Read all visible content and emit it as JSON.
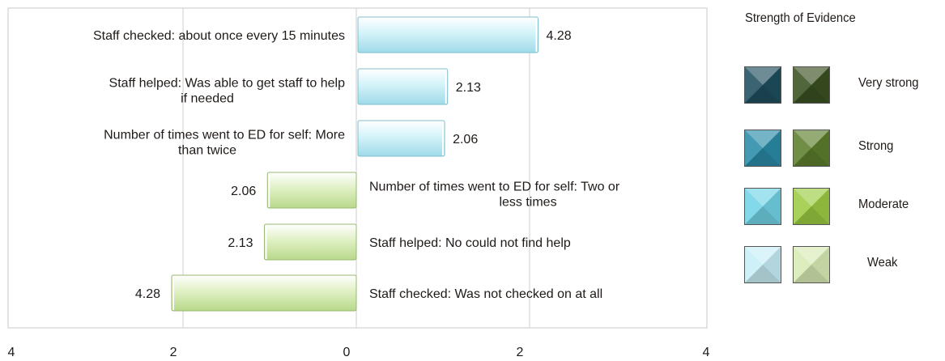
{
  "chart_data": {
    "type": "bar",
    "orientation": "horizontal",
    "xlim": [
      -4,
      4
    ],
    "x_tick_labels": [
      "4",
      "2",
      "0",
      "2",
      "4"
    ],
    "bars": [
      {
        "label": "Staff checked: about once every 15 minutes",
        "value": 4.28,
        "value_label": "4.28",
        "direction": "right",
        "strength": "Moderate",
        "group": "blue"
      },
      {
        "label": "Staff helped: Was able to get staff to help if needed",
        "value": 2.13,
        "value_label": "2.13",
        "direction": "right",
        "strength": "Weak",
        "group": "blue"
      },
      {
        "label": "Number of times went to ED for self: More than twice",
        "value": 2.06,
        "value_label": "2.06",
        "direction": "right",
        "strength": "Weak",
        "group": "blue"
      },
      {
        "label": "Number of times went to ED for self: Two or less times",
        "value": 2.06,
        "value_label": "2.06",
        "direction": "left",
        "strength": "Weak",
        "group": "green"
      },
      {
        "label": "Staff helped: No could not find help",
        "value": 2.13,
        "value_label": "2.13",
        "direction": "left",
        "strength": "Weak",
        "group": "green"
      },
      {
        "label": "Staff checked: Was not checked on at all",
        "value": 4.28,
        "value_label": "4.28",
        "direction": "left",
        "strength": "Weak",
        "group": "green"
      }
    ],
    "grid": true,
    "legend_position": "right"
  },
  "legend": {
    "title": "Strength of Evidence",
    "items": [
      {
        "label": "Very strong",
        "blue": "#1f4f5e",
        "green": "#3b5121"
      },
      {
        "label": "Strong",
        "blue": "#2b8ca8",
        "green": "#5d7f2c"
      },
      {
        "label": "Moderate",
        "blue": "#72d3e6",
        "green": "#9ccc43"
      },
      {
        "label": "Weak",
        "blue": "#c8eef6",
        "green": "#d9ecb5"
      }
    ]
  },
  "colors": {
    "bar_blue": "#c8eef6",
    "bar_green": "#d9ecb5",
    "axis": "#9a9a9a",
    "text": "#1f1a17"
  }
}
